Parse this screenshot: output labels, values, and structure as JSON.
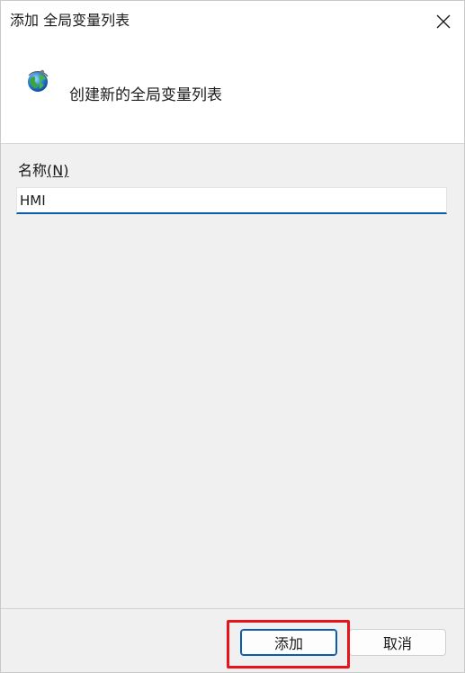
{
  "window": {
    "title": "添加 全局变量列表",
    "close_icon": "close-icon"
  },
  "header": {
    "icon": "globe-icon",
    "text": "创建新的全局变量列表"
  },
  "form": {
    "name_label": "名称",
    "name_label_mnemonic": "(N)",
    "name_value": "HMI"
  },
  "buttons": {
    "add_label": "添加",
    "cancel_label": "取消"
  },
  "colors": {
    "accent": "#0b5cad",
    "highlight": "#e8141b"
  }
}
